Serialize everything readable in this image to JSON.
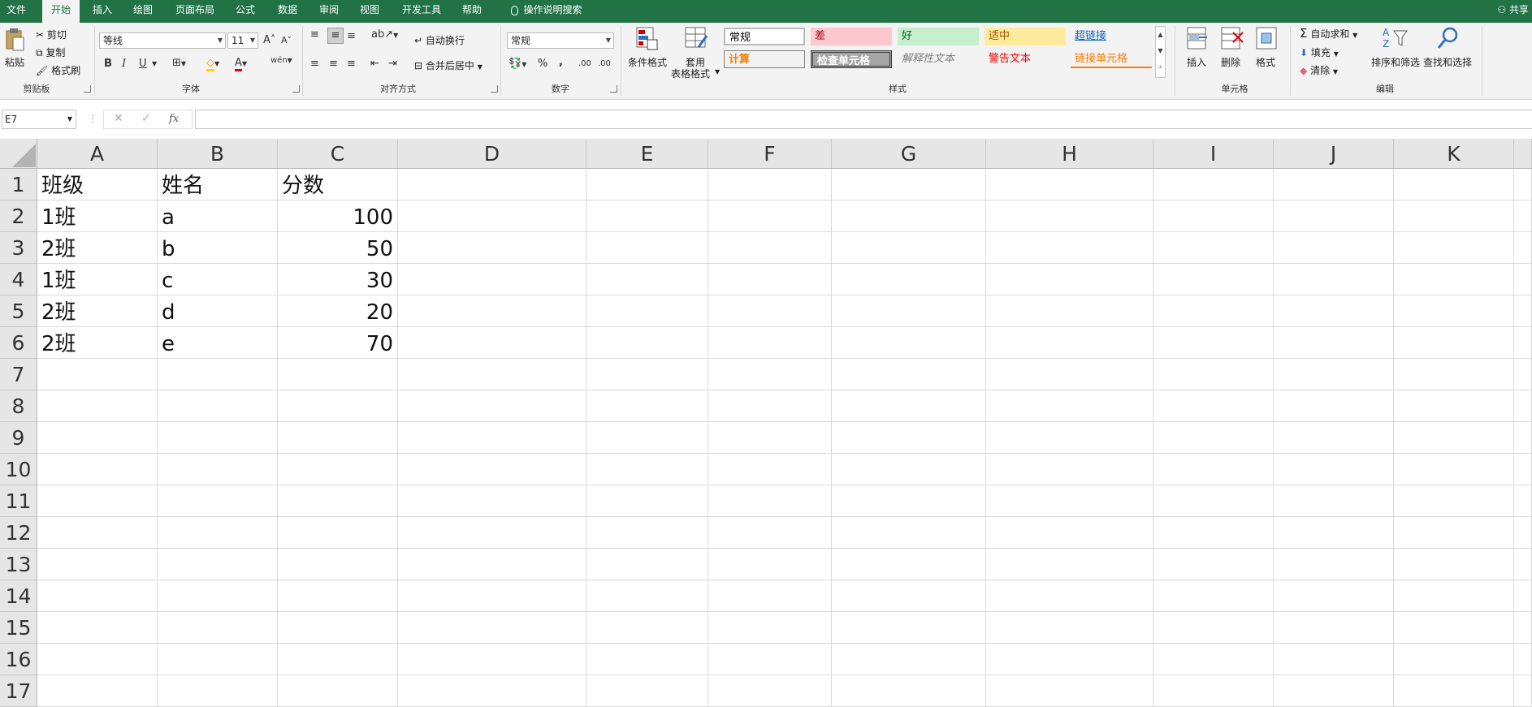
{
  "menu": {
    "tabs": [
      "文件",
      "开始",
      "插入",
      "绘图",
      "页面布局",
      "公式",
      "数据",
      "审阅",
      "视图",
      "开发工具",
      "帮助"
    ],
    "tell_me": "操作说明搜索",
    "share": "共享"
  },
  "ribbon": {
    "clipboard": {
      "paste": "粘贴",
      "cut": "剪切",
      "copy": "复制",
      "format_painter": "格式刷",
      "label": "剪贴板"
    },
    "font": {
      "name": "等线",
      "size": "11",
      "bold": "B",
      "italic": "I",
      "underline": "U",
      "grow": "A",
      "shrink": "A",
      "font_color": "A",
      "phonetic": "wén",
      "label": "字体"
    },
    "alignment": {
      "wrap": "自动换行",
      "merge": "合并后居中",
      "label": "对齐方式"
    },
    "number": {
      "format": "常规",
      "percent": "%",
      "comma": ",",
      "inc_decimal": ".00",
      "dec_decimal": ".00",
      "label": "数字"
    },
    "styles": {
      "conditional": "条件格式",
      "table_line1": "套用",
      "table_line2": "表格格式",
      "cells": [
        {
          "label": "常规",
          "bg": "#ffffff",
          "fg": "#000000"
        },
        {
          "label": "差",
          "bg": "#ffc7ce",
          "fg": "#9c0006"
        },
        {
          "label": "好",
          "bg": "#c6efce",
          "fg": "#006100"
        },
        {
          "label": "适中",
          "bg": "#ffeb9c",
          "fg": "#9c5700"
        },
        {
          "label": "超链接",
          "bg": "transparent",
          "fg": "#0563c1"
        },
        {
          "label": "计算",
          "bg": "#f2f2f2",
          "fg": "#fa7d00"
        },
        {
          "label": "检查单元格",
          "bg": "#a5a5a5",
          "fg": "#ffffff"
        },
        {
          "label": "解释性文本",
          "bg": "transparent",
          "fg": "#7f7f7f"
        },
        {
          "label": "警告文本",
          "bg": "transparent",
          "fg": "#ff0000"
        },
        {
          "label": "链接单元格",
          "bg": "transparent",
          "fg": "#fa7d00"
        }
      ],
      "label": "样式"
    },
    "cells": {
      "insert": "插入",
      "delete": "删除",
      "format": "格式",
      "label": "单元格"
    },
    "editing": {
      "autosum": "自动求和",
      "fill": "填充",
      "clear": "清除",
      "sort": "排序和筛选",
      "find": "查找和选择",
      "label": "编辑"
    }
  },
  "formula_bar": {
    "name_box": "E7",
    "fx": "fx",
    "cancel": "✕",
    "enter": "✓",
    "formula": ""
  },
  "sheet": {
    "columns": [
      "A",
      "B",
      "C",
      "D",
      "E",
      "F",
      "G",
      "H",
      "I",
      "J",
      "K"
    ],
    "rows": [
      "1",
      "2",
      "3",
      "4",
      "5",
      "6",
      "7",
      "8",
      "9",
      "10",
      "11",
      "12",
      "13",
      "14",
      "15",
      "16",
      "17"
    ],
    "cells": [
      [
        "班级",
        "姓名",
        "分数"
      ],
      [
        "1班",
        "a",
        "100"
      ],
      [
        "2班",
        "b",
        "50"
      ],
      [
        "1班",
        "c",
        "30"
      ],
      [
        "2班",
        "d",
        "20"
      ],
      [
        "2班",
        "e",
        "70"
      ]
    ]
  },
  "colors": {
    "accent": "#217346"
  }
}
